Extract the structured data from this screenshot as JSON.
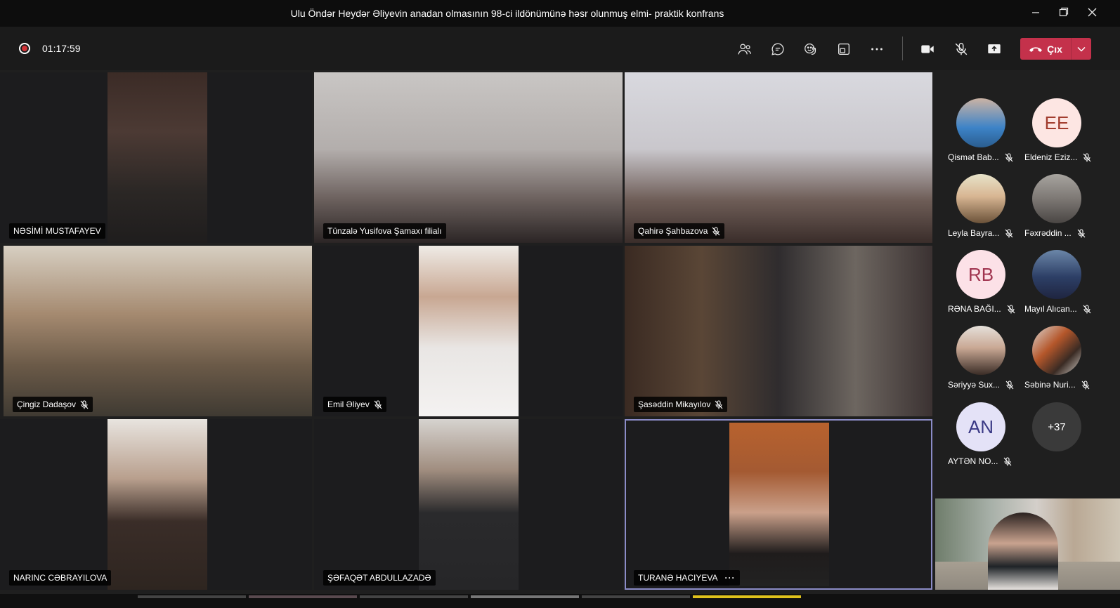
{
  "window": {
    "title": "Ulu Öndər Heydər Əliyevin anadan olmasının 98-ci ildönümünə həsr olunmuş elmi- praktik konfrans"
  },
  "toolbar": {
    "timer": "01:17:59",
    "leave_label": "Çıx"
  },
  "tiles": [
    {
      "name": "NƏSİMİ MUSTAFAYEV",
      "muted": false
    },
    {
      "name": "Tünzalə Yusifova Şamaxı filialı",
      "muted": false
    },
    {
      "name": "Qahirə Şahbazova",
      "muted": true
    },
    {
      "name": "Çingiz Dadaşov",
      "muted": true
    },
    {
      "name": "Emil Əliyev",
      "muted": true
    },
    {
      "name": "Şasəddin Mikayılov",
      "muted": true
    },
    {
      "name": "NARINC CƏBRAYILOVA",
      "muted": false
    },
    {
      "name": "ŞƏFAQƏT ABDULLAZADƏ",
      "muted": false
    },
    {
      "name": "TURANƏ HACIYEVA",
      "muted": false
    }
  ],
  "roster": [
    {
      "name": "Qismət Bab...",
      "initials": ""
    },
    {
      "name": "Eldeniz Eziz...",
      "initials": "EE"
    },
    {
      "name": "Leyla Bayra...",
      "initials": ""
    },
    {
      "name": "Fəxrəddin ...",
      "initials": ""
    },
    {
      "name": "RƏNA BAĞI...",
      "initials": "RB"
    },
    {
      "name": "Mayıl Alıcan...",
      "initials": ""
    },
    {
      "name": "Səriyyə Sux...",
      "initials": ""
    },
    {
      "name": "Səbinə Nuri...",
      "initials": ""
    },
    {
      "name": "AYTƏN NO...",
      "initials": "AN"
    }
  ],
  "more_count": "+37",
  "colors": {
    "leave": "#c4314b",
    "record": "#d13438",
    "selected_border": "#8b8cc7"
  }
}
